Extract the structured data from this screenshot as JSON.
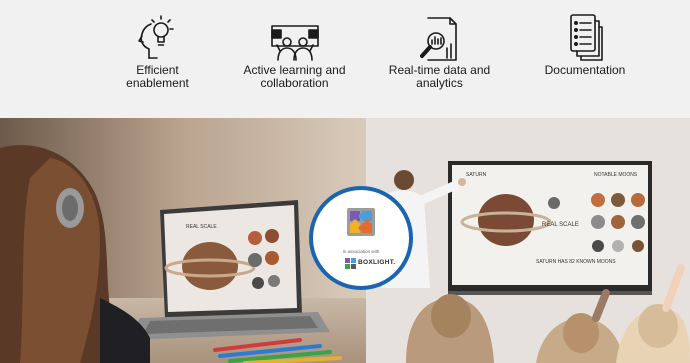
{
  "features": [
    {
      "icon": "lightbulb-head-icon",
      "label": "Efficient\nenablement"
    },
    {
      "icon": "collaboration-board-icon",
      "label": "Active learning and\ncollaboration"
    },
    {
      "icon": "analytics-magnifier-icon",
      "label": "Real-time data  and\nanalytics"
    },
    {
      "icon": "documents-icon",
      "label": "Documentation"
    }
  ],
  "badge": {
    "association_text": "In association with",
    "brand_name": "BOXLIGHT."
  },
  "screens": {
    "laptop_title": "REAL SCALE",
    "board_title": "SATURN",
    "board_moons_title": "NOTABLE MOONS",
    "board_center_title": "REAL SCALE",
    "board_bottom_title": "SATURN HAS 82\nKNOWN MOONS"
  },
  "colors": {
    "badge_border": "#1b64b0",
    "features_bg": "#f1f1f1"
  }
}
